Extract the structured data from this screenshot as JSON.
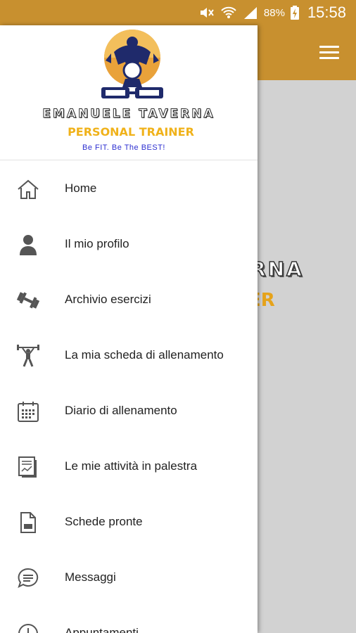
{
  "status_bar": {
    "battery_percent": "88%",
    "time": "15:58",
    "icons": [
      "mute-icon",
      "wifi-icon",
      "signal-icon",
      "battery-charging-icon"
    ]
  },
  "app_bar": {
    "color": "#c8902f",
    "menu_icon": "hamburger-menu-icon"
  },
  "background_content": {
    "title_fragment": "ERNA",
    "subtitle_fragment": "ER"
  },
  "drawer": {
    "header": {
      "logo": "bodybuilder-logo",
      "name": "EMANUELE TAVERNA",
      "role": "PERSONAL TRAINER",
      "motto": "Be FIT. Be The BEST!"
    },
    "items": [
      {
        "label": "Home",
        "icon": "home-icon"
      },
      {
        "label": "Il mio profilo",
        "icon": "person-icon"
      },
      {
        "label": "Archivio esercizi",
        "icon": "dumbbell-icon"
      },
      {
        "label": "La mia scheda di allenamento",
        "icon": "weightlifter-icon"
      },
      {
        "label": "Diario di allenamento",
        "icon": "calendar-icon"
      },
      {
        "label": "Le mie attività in palestra",
        "icon": "activity-report-icon"
      },
      {
        "label": "Schede pronte",
        "icon": "document-icon"
      },
      {
        "label": "Messaggi",
        "icon": "message-icon"
      },
      {
        "label": "Appuntamenti",
        "icon": "clock-icon"
      }
    ]
  }
}
